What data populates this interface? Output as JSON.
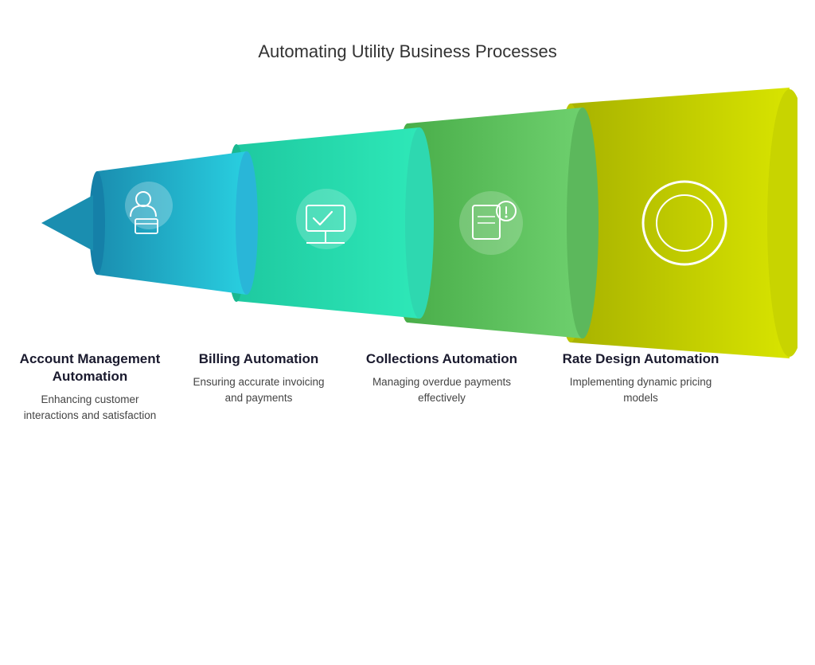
{
  "page": {
    "title": "Automating Utility Business Processes"
  },
  "segments": [
    {
      "id": "account",
      "title": "Account Management Automation",
      "description": "Enhancing customer interactions and satisfaction",
      "color_start": "#29b6d8",
      "color_end": "#1a8eb0"
    },
    {
      "id": "billing",
      "title": "Billing Automation",
      "description": "Ensuring accurate invoicing and payments",
      "color_start": "#2ecba0",
      "color_end": "#1da882"
    },
    {
      "id": "collections",
      "title": "Collections Automation",
      "description": "Managing overdue payments effectively",
      "color_start": "#5cb85c",
      "color_end": "#4a9e4a"
    },
    {
      "id": "rate",
      "title": "Rate Design Automation",
      "description": "Implementing dynamic pricing models",
      "color_start": "#c8d400",
      "color_end": "#a8b200"
    }
  ],
  "icons": {
    "account": "👤",
    "billing": "🖥",
    "collections": "📋",
    "rate": "⭕"
  }
}
